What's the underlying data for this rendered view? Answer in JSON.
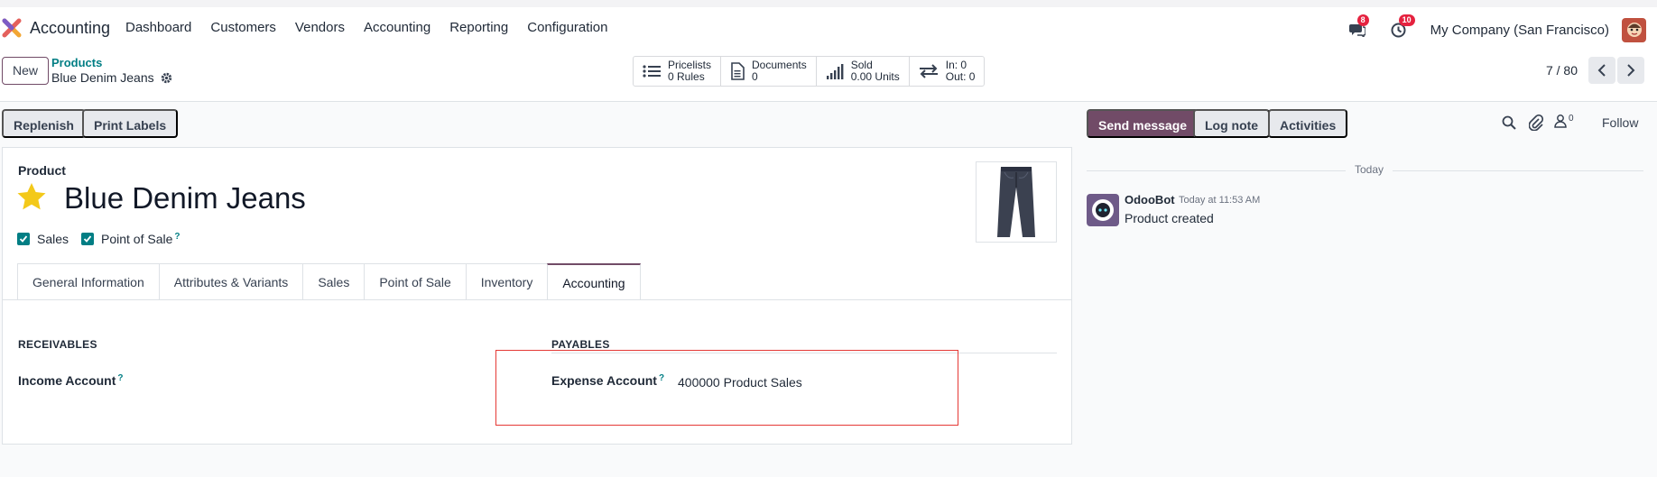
{
  "navbar": {
    "app_name": "Accounting",
    "menu": [
      "Dashboard",
      "Customers",
      "Vendors",
      "Accounting",
      "Reporting",
      "Configuration"
    ],
    "messages_badge": "8",
    "activities_badge": "10",
    "company": "My Company (San Francisco)"
  },
  "control": {
    "new_label": "New",
    "breadcrumb_parent": "Products",
    "breadcrumb_current": "Blue Denim Jeans",
    "smart_buttons": [
      {
        "icon": "list-icon",
        "line1": "Pricelists",
        "line2": "0 Rules"
      },
      {
        "icon": "document-icon",
        "line1": "Documents",
        "line2": "0"
      },
      {
        "icon": "bar-chart-icon",
        "line1": "Sold",
        "line2": "0.00 Units"
      },
      {
        "icon": "transfer-arrows-icon",
        "line1": "In: 0",
        "line2": "Out: 0"
      }
    ],
    "pager": "7 / 80"
  },
  "actions": {
    "replenish": "Replenish",
    "print_labels": "Print Labels"
  },
  "form": {
    "product_label": "Product",
    "product_name": "Blue Denim Jeans",
    "checkbox_sales": "Sales",
    "checkbox_pos": "Point of Sale",
    "help_mark": "?",
    "tabs": [
      "General Information",
      "Attributes & Variants",
      "Sales",
      "Point of Sale",
      "Inventory",
      "Accounting"
    ],
    "active_tab": "Accounting",
    "receivables_title": "RECEIVABLES",
    "payables_title": "PAYABLES",
    "income_account_label": "Income Account",
    "expense_account_label": "Expense Account",
    "expense_account_value": "400000 Product Sales"
  },
  "chatter": {
    "send_message": "Send message",
    "log_note": "Log note",
    "activities": "Activities",
    "followers_count": "0",
    "follow": "Follow",
    "date_separator": "Today",
    "messages": [
      {
        "author": "OdooBot",
        "time": "Today at 11:53 AM",
        "body": "Product created"
      }
    ]
  },
  "colors": {
    "brand": "#714b67",
    "teal": "#017e84",
    "badge": "#e5223f",
    "highlight_box": "#e53935"
  }
}
